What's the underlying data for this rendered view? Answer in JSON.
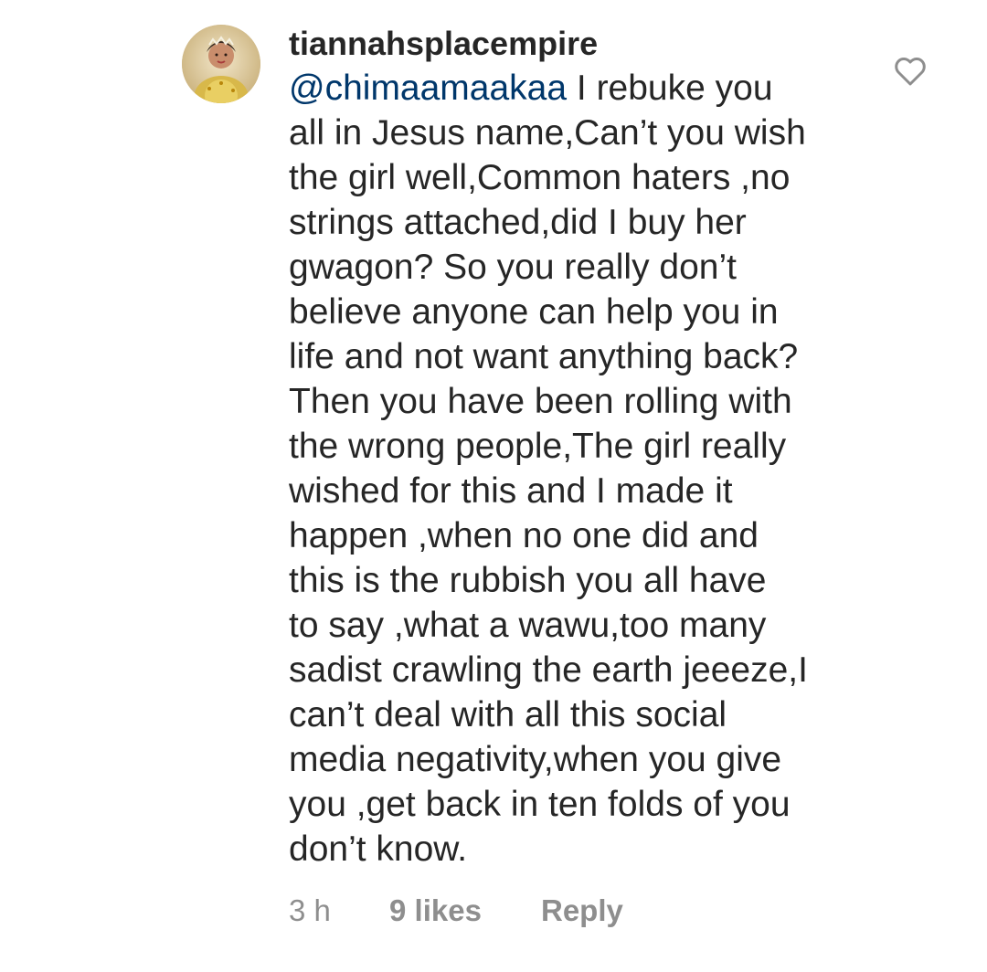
{
  "comment": {
    "avatar_icon": "profile-photo",
    "username": "tiannahsplacempire",
    "mention": "@chimaamaakaa",
    "text": " I rebuke you\nall in Jesus name,Can’t you wish\nthe girl well,Common haters ,no\nstrings attached,did I buy her\ngwagon? So you really don’t\nbelieve anyone can help you in\nlife and not want anything back?\nThen you have been rolling with\nthe wrong people,The girl really\nwished for this and I made it\nhappen ,when no one did and\nthis is the rubbish you all have\nto say ,what a wawu,too many\nsadist crawling the earth jeeeze,I\ncan’t deal with all this social\nmedia negativity,when you give\nyou ,get back in ten folds of you\ndon’t know.",
    "time": "3 h",
    "likes": "9 likes",
    "reply_label": "Reply",
    "like_icon": "heart-outline",
    "colors": {
      "text": "#262626",
      "mention": "#00376b",
      "meta": "#8e8e8e"
    }
  }
}
